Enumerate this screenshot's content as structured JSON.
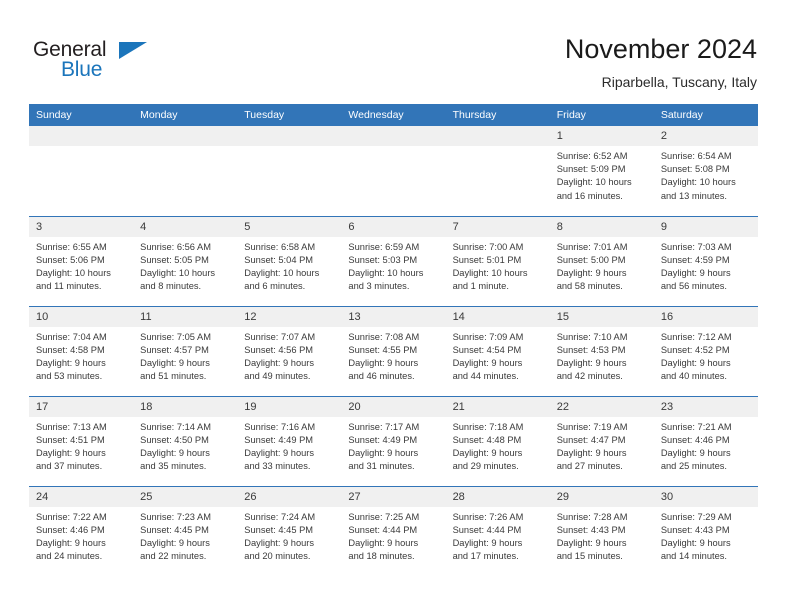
{
  "brand": {
    "name_part1": "General",
    "name_part2": "Blue",
    "triangle_icon": "triangle-icon",
    "color_dark": "#231f20",
    "color_blue": "#1b75bb"
  },
  "header": {
    "title": "November 2024",
    "subtitle": "Riparbella, Tuscany, Italy"
  },
  "calendar": {
    "header_bg": "#3275b8",
    "daynum_bg": "#f0f0f0",
    "weekday_headers": [
      "Sunday",
      "Monday",
      "Tuesday",
      "Wednesday",
      "Thursday",
      "Friday",
      "Saturday"
    ],
    "weeks": [
      [
        {
          "day": "",
          "lines": []
        },
        {
          "day": "",
          "lines": []
        },
        {
          "day": "",
          "lines": []
        },
        {
          "day": "",
          "lines": []
        },
        {
          "day": "",
          "lines": []
        },
        {
          "day": "1",
          "lines": [
            "Sunrise: 6:52 AM",
            "Sunset: 5:09 PM",
            "Daylight: 10 hours",
            "and 16 minutes."
          ]
        },
        {
          "day": "2",
          "lines": [
            "Sunrise: 6:54 AM",
            "Sunset: 5:08 PM",
            "Daylight: 10 hours",
            "and 13 minutes."
          ]
        }
      ],
      [
        {
          "day": "3",
          "lines": [
            "Sunrise: 6:55 AM",
            "Sunset: 5:06 PM",
            "Daylight: 10 hours",
            "and 11 minutes."
          ]
        },
        {
          "day": "4",
          "lines": [
            "Sunrise: 6:56 AM",
            "Sunset: 5:05 PM",
            "Daylight: 10 hours",
            "and 8 minutes."
          ]
        },
        {
          "day": "5",
          "lines": [
            "Sunrise: 6:58 AM",
            "Sunset: 5:04 PM",
            "Daylight: 10 hours",
            "and 6 minutes."
          ]
        },
        {
          "day": "6",
          "lines": [
            "Sunrise: 6:59 AM",
            "Sunset: 5:03 PM",
            "Daylight: 10 hours",
            "and 3 minutes."
          ]
        },
        {
          "day": "7",
          "lines": [
            "Sunrise: 7:00 AM",
            "Sunset: 5:01 PM",
            "Daylight: 10 hours",
            "and 1 minute."
          ]
        },
        {
          "day": "8",
          "lines": [
            "Sunrise: 7:01 AM",
            "Sunset: 5:00 PM",
            "Daylight: 9 hours",
            "and 58 minutes."
          ]
        },
        {
          "day": "9",
          "lines": [
            "Sunrise: 7:03 AM",
            "Sunset: 4:59 PM",
            "Daylight: 9 hours",
            "and 56 minutes."
          ]
        }
      ],
      [
        {
          "day": "10",
          "lines": [
            "Sunrise: 7:04 AM",
            "Sunset: 4:58 PM",
            "Daylight: 9 hours",
            "and 53 minutes."
          ]
        },
        {
          "day": "11",
          "lines": [
            "Sunrise: 7:05 AM",
            "Sunset: 4:57 PM",
            "Daylight: 9 hours",
            "and 51 minutes."
          ]
        },
        {
          "day": "12",
          "lines": [
            "Sunrise: 7:07 AM",
            "Sunset: 4:56 PM",
            "Daylight: 9 hours",
            "and 49 minutes."
          ]
        },
        {
          "day": "13",
          "lines": [
            "Sunrise: 7:08 AM",
            "Sunset: 4:55 PM",
            "Daylight: 9 hours",
            "and 46 minutes."
          ]
        },
        {
          "day": "14",
          "lines": [
            "Sunrise: 7:09 AM",
            "Sunset: 4:54 PM",
            "Daylight: 9 hours",
            "and 44 minutes."
          ]
        },
        {
          "day": "15",
          "lines": [
            "Sunrise: 7:10 AM",
            "Sunset: 4:53 PM",
            "Daylight: 9 hours",
            "and 42 minutes."
          ]
        },
        {
          "day": "16",
          "lines": [
            "Sunrise: 7:12 AM",
            "Sunset: 4:52 PM",
            "Daylight: 9 hours",
            "and 40 minutes."
          ]
        }
      ],
      [
        {
          "day": "17",
          "lines": [
            "Sunrise: 7:13 AM",
            "Sunset: 4:51 PM",
            "Daylight: 9 hours",
            "and 37 minutes."
          ]
        },
        {
          "day": "18",
          "lines": [
            "Sunrise: 7:14 AM",
            "Sunset: 4:50 PM",
            "Daylight: 9 hours",
            "and 35 minutes."
          ]
        },
        {
          "day": "19",
          "lines": [
            "Sunrise: 7:16 AM",
            "Sunset: 4:49 PM",
            "Daylight: 9 hours",
            "and 33 minutes."
          ]
        },
        {
          "day": "20",
          "lines": [
            "Sunrise: 7:17 AM",
            "Sunset: 4:49 PM",
            "Daylight: 9 hours",
            "and 31 minutes."
          ]
        },
        {
          "day": "21",
          "lines": [
            "Sunrise: 7:18 AM",
            "Sunset: 4:48 PM",
            "Daylight: 9 hours",
            "and 29 minutes."
          ]
        },
        {
          "day": "22",
          "lines": [
            "Sunrise: 7:19 AM",
            "Sunset: 4:47 PM",
            "Daylight: 9 hours",
            "and 27 minutes."
          ]
        },
        {
          "day": "23",
          "lines": [
            "Sunrise: 7:21 AM",
            "Sunset: 4:46 PM",
            "Daylight: 9 hours",
            "and 25 minutes."
          ]
        }
      ],
      [
        {
          "day": "24",
          "lines": [
            "Sunrise: 7:22 AM",
            "Sunset: 4:46 PM",
            "Daylight: 9 hours",
            "and 24 minutes."
          ]
        },
        {
          "day": "25",
          "lines": [
            "Sunrise: 7:23 AM",
            "Sunset: 4:45 PM",
            "Daylight: 9 hours",
            "and 22 minutes."
          ]
        },
        {
          "day": "26",
          "lines": [
            "Sunrise: 7:24 AM",
            "Sunset: 4:45 PM",
            "Daylight: 9 hours",
            "and 20 minutes."
          ]
        },
        {
          "day": "27",
          "lines": [
            "Sunrise: 7:25 AM",
            "Sunset: 4:44 PM",
            "Daylight: 9 hours",
            "and 18 minutes."
          ]
        },
        {
          "day": "28",
          "lines": [
            "Sunrise: 7:26 AM",
            "Sunset: 4:44 PM",
            "Daylight: 9 hours",
            "and 17 minutes."
          ]
        },
        {
          "day": "29",
          "lines": [
            "Sunrise: 7:28 AM",
            "Sunset: 4:43 PM",
            "Daylight: 9 hours",
            "and 15 minutes."
          ]
        },
        {
          "day": "30",
          "lines": [
            "Sunrise: 7:29 AM",
            "Sunset: 4:43 PM",
            "Daylight: 9 hours",
            "and 14 minutes."
          ]
        }
      ]
    ]
  }
}
